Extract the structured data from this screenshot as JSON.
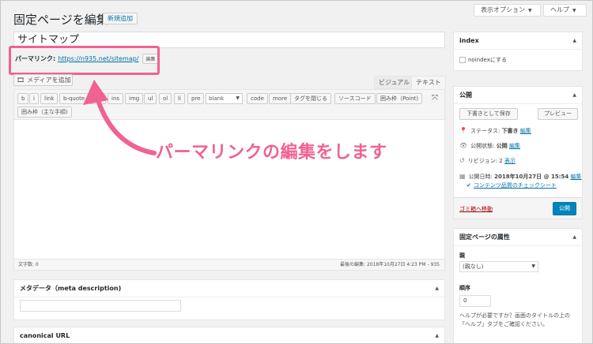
{
  "header": {
    "title": "固定ページを編集",
    "add_new": "新規追加",
    "screen_options": "表示オプション",
    "help": "ヘルプ"
  },
  "post": {
    "title": "サイトマップ",
    "permalink_label": "パーマリンク:",
    "permalink_url": "https://n935.net/sitemap/",
    "permalink_edit": "編集"
  },
  "editor": {
    "add_media": "メディアを追加",
    "tab_visual": "ビジュアル",
    "tab_text": "テキスト",
    "buttons_row1": [
      "b",
      "i",
      "link",
      "b-quote",
      "del",
      "ins",
      "img",
      "ul",
      "ol",
      "li",
      "pre"
    ],
    "select_value": "blank",
    "buttons_row1_after": [
      "code",
      "more",
      "タグを閉じる",
      "ソースコード",
      "囲み枠（Point)"
    ],
    "buttons_row2": [
      "囲み枠（主な手順)"
    ],
    "word_count": "文字数: 0",
    "last_edit": "最後の編集: 2018年10月27日 4:23 PM - 935"
  },
  "annotation": {
    "text": "パーマリンクの編集をします",
    "color": "#f06292"
  },
  "meta_box": {
    "title": "メタデータ（meta description)"
  },
  "canonical_box": {
    "title": "canonical URL"
  },
  "index_box": {
    "title": "index",
    "checkbox_label": "noindexにする"
  },
  "publish_box": {
    "title": "公開",
    "save_draft": "下書きとして保存",
    "preview": "プレビュー",
    "status_label": "ステータス:",
    "status_value": "下書き",
    "status_edit": "編集",
    "visibility_label": "公開状態:",
    "visibility_value": "公開",
    "visibility_edit": "編集",
    "revisions_label": "リビジョン: 2",
    "revisions_link": "表示",
    "schedule_label": "公開日時:",
    "schedule_value": "2018年10月27日 @ 15:54",
    "schedule_edit": "編集",
    "checklist": "コンテンツ品質のチェックシート",
    "trash": "ゴミ箱へ移動",
    "publish": "公開"
  },
  "attributes_box": {
    "title": "固定ページの属性",
    "parent_label": "親",
    "parent_value": "(親なし)",
    "order_label": "順序",
    "order_value": "0",
    "help_text": "ヘルプが必要ですか？画面のタイトルの上の「ヘルプ」タブをご確認ください。"
  },
  "colors": {
    "accent": "#f06292",
    "link": "#0073aa",
    "primary_button": "#0085ba",
    "trash": "#aa0000"
  }
}
